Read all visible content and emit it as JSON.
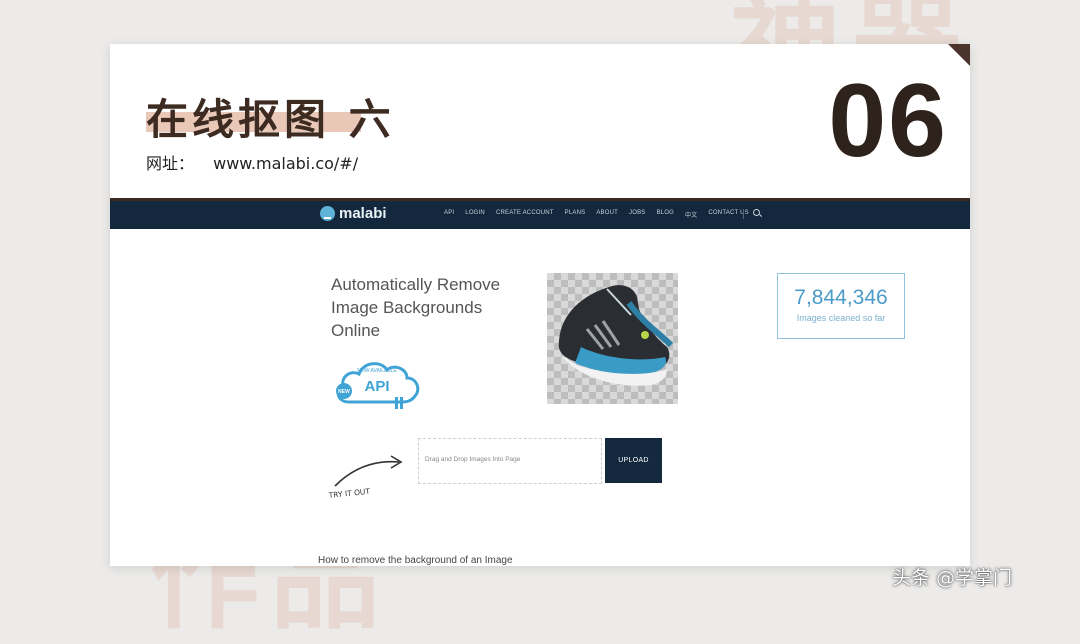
{
  "slide": {
    "bg_top_chars": "神器",
    "bg_bottom_chars": "作品",
    "title": "在线抠图 六",
    "site_label": "网址：",
    "site_url": "www.malabi.co/#/",
    "number": "06"
  },
  "malabi": {
    "logo": "malabi",
    "nav_links": [
      "API",
      "LOGIN",
      "CREATE ACCOUNT",
      "PLANS",
      "ABOUT",
      "JOBS",
      "BLOG",
      "中文",
      "CONTACT US"
    ],
    "headline": "Automatically Remove Image Backgrounds Online",
    "api_badge_small": "NOW AVAILABLE",
    "api_badge_big": "API",
    "api_badge_new": "NEW",
    "counter_value": "7,844,346",
    "counter_label": "Images cleaned so far",
    "try_it_out": "TRY IT OUT",
    "drop_placeholder": "Drag and Drop Images Into Page",
    "upload_label": "UPLOAD",
    "howto": "How to remove the background of an Image"
  },
  "watermark": "头条 @学掌门",
  "colors": {
    "accent_brown": "#3d2b22",
    "highlight": "#e9c8b8",
    "nav_bg": "#13283c",
    "malabi_blue": "#4a9bc9"
  }
}
